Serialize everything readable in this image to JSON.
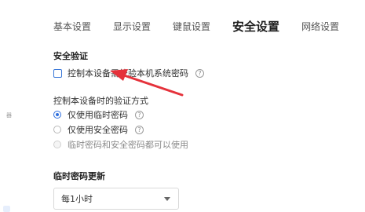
{
  "tabs": [
    {
      "label": "基本设置",
      "active": false
    },
    {
      "label": "显示设置",
      "active": false
    },
    {
      "label": "键鼠设置",
      "active": false
    },
    {
      "label": "安全设置",
      "active": true
    },
    {
      "label": "网络设置",
      "active": false
    }
  ],
  "left_panel": {
    "glyph": "器"
  },
  "security_verification": {
    "title": "安全验证",
    "checkbox": {
      "label": "控制本设备需校验本机系统密码",
      "checked": false,
      "help_icon": "?"
    }
  },
  "verification_mode": {
    "title": "控制本设备时的验证方式",
    "options": [
      {
        "label": "仅使用临时密码",
        "checked": true,
        "disabled": false,
        "help_icon": "?"
      },
      {
        "label": "仅使用安全密码",
        "checked": false,
        "disabled": false,
        "help_icon": "?"
      },
      {
        "label": "临时密码和安全密码都可以使用",
        "checked": false,
        "disabled": true
      }
    ]
  },
  "temp_password_update": {
    "title": "临时密码更新",
    "select": {
      "value": "每1小时"
    }
  },
  "colors": {
    "accent": "#2f6fde",
    "annotation_arrow": "#e5323b"
  }
}
